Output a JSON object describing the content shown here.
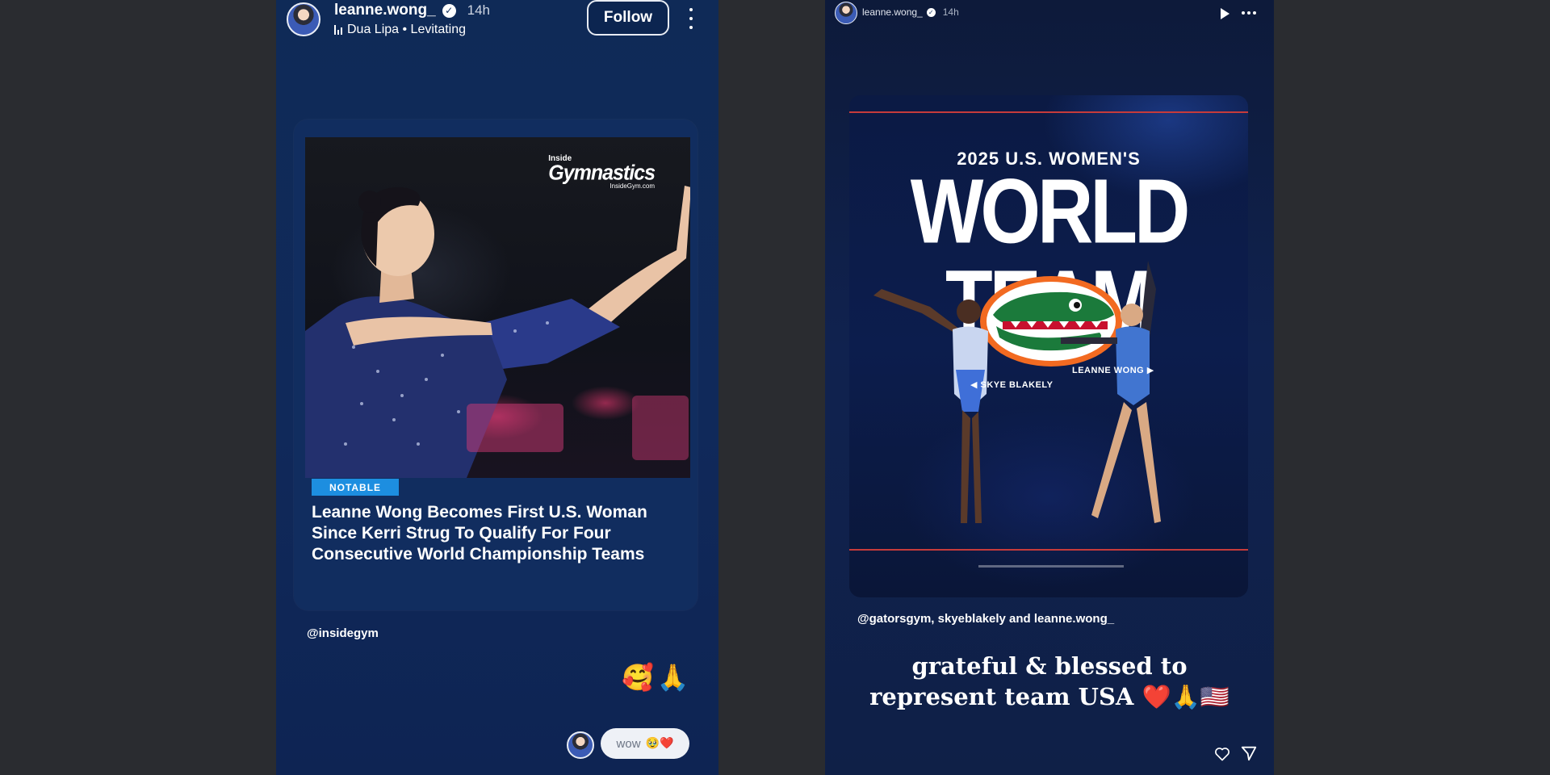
{
  "left_story": {
    "username": "leanne.wong_",
    "time": "14h",
    "music": "Dua Lipa • Levitating",
    "follow_label": "Follow",
    "article": {
      "logo_line1": "Inside",
      "logo_line2": "Gymnastics",
      "logo_line3": "InsideGym.com",
      "badge": "NOTABLE",
      "headline": "Leanne Wong Becomes First U.S. Woman Since Kerri Strug To Qualify For Four Consecutive World Championship Teams"
    },
    "credit": "@insidegym",
    "reaction_emojis": "🥰🙏",
    "reply": {
      "text": "wow",
      "emojis": "🥹❤️"
    }
  },
  "right_story": {
    "username": "leanne.wong_",
    "time": "14h",
    "poster": {
      "subtitle": "2025 U.S. WOMEN'S",
      "title": "WORLD TEAM",
      "label_left": "◀ SKYE BLAKELY",
      "label_right": "LEANNE WONG ▶"
    },
    "credit": "@gatorsgym, skyeblakely and leanne.wong_",
    "caption_line1": "grateful & blessed to",
    "caption_line2": "represent team USA ❤️🙏🇺🇸"
  },
  "colors": {
    "page_bg": "#2a2c30",
    "left_story_bg": "#10295a",
    "badge": "#1d8ee0",
    "poster_accent": "#c63b3b"
  },
  "icons": [
    "verified-icon",
    "music-icon",
    "kebab-menu-icon",
    "play-icon",
    "more-icon",
    "heart-icon",
    "send-icon"
  ]
}
